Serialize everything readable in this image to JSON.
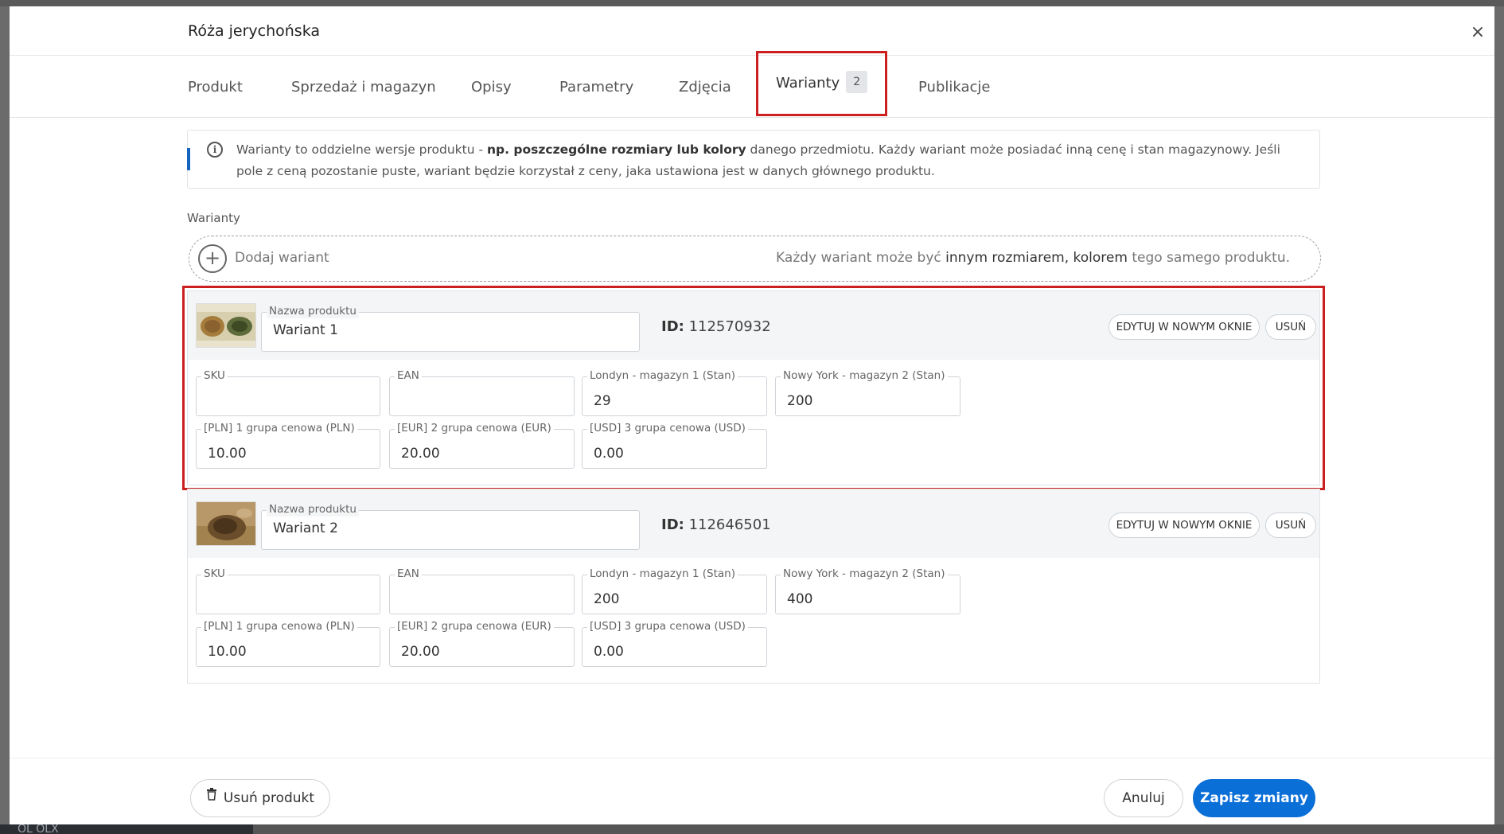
{
  "modal": {
    "title": "Róża jerychońska",
    "close_label": "×"
  },
  "tabs": [
    {
      "label": "Produkt"
    },
    {
      "label": "Sprzedaż i magazyn"
    },
    {
      "label": "Opisy"
    },
    {
      "label": "Parametry"
    },
    {
      "label": "Zdjęcia"
    },
    {
      "label": "Warianty",
      "badge": "2",
      "active": true
    },
    {
      "label": "Publikacje"
    }
  ],
  "info": {
    "text_part1": "Warianty to oddzielne wersje produktu - ",
    "text_bold": "np. poszczególne rozmiary lub kolory",
    "text_part2": " danego przedmiotu. Każdy wariant może posiadać inną cenę i stan magazynowy. Jeśli pole z ceną pozostanie puste, wariant będzie korzystał z ceny, jaka ustawiona jest w danych głównego produktu."
  },
  "variants_section": {
    "label": "Warianty",
    "add_label": "Dodaj wariant",
    "hint_part1": "Każdy wariant może być ",
    "hint_bold": "innym rozmiarem, kolorem",
    "hint_part2": " tego samego produktu."
  },
  "variants": [
    {
      "name_label": "Nazwa produktu",
      "name": "Wariant 1",
      "id_label": "ID:",
      "id": "112570932",
      "edit_label": "EDYTUJ W NOWYM OKNIE",
      "delete_label": "USUŃ",
      "fields": [
        {
          "label": "SKU",
          "value": ""
        },
        {
          "label": "EAN",
          "value": ""
        },
        {
          "label": "Londyn - magazyn 1 (Stan)",
          "value": "29"
        },
        {
          "label": "Nowy York - magazyn 2 (Stan)",
          "value": "200"
        },
        {
          "label": "[PLN] 1 grupa cenowa (PLN)",
          "value": "10.00"
        },
        {
          "label": "[EUR] 2 grupa cenowa (EUR)",
          "value": "20.00"
        },
        {
          "label": "[USD] 3 grupa cenowa (USD)",
          "value": "0.00"
        }
      ]
    },
    {
      "name_label": "Nazwa produktu",
      "name": "Wariant 2",
      "id_label": "ID:",
      "id": "112646501",
      "edit_label": "EDYTUJ W NOWYM OKNIE",
      "delete_label": "USUŃ",
      "fields": [
        {
          "label": "SKU",
          "value": ""
        },
        {
          "label": "EAN",
          "value": ""
        },
        {
          "label": "Londyn - magazyn 1 (Stan)",
          "value": "200"
        },
        {
          "label": "Nowy York - magazyn 2 (Stan)",
          "value": "400"
        },
        {
          "label": "[PLN] 1 grupa cenowa (PLN)",
          "value": "10.00"
        },
        {
          "label": "[EUR] 2 grupa cenowa (EUR)",
          "value": "20.00"
        },
        {
          "label": "[USD] 3 grupa cenowa (USD)",
          "value": "0.00"
        }
      ]
    }
  ],
  "footer": {
    "delete_product_label": "Usuń produkt",
    "cancel_label": "Anuluj",
    "save_label": "Zapisz zmiany"
  },
  "background": {
    "sidebar_text": "OL  OLX"
  },
  "colors": {
    "primary": "#0b6fd8",
    "highlight": "#cc1f1f",
    "info_accent": "#1565c0"
  }
}
